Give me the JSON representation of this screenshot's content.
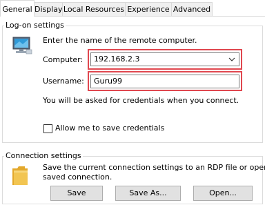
{
  "tabs": [
    "General",
    "Display",
    "Local Resources",
    "Experience",
    "Advanced"
  ],
  "logon": {
    "legend": "Log-on settings",
    "instruction": "Enter the name of the remote computer.",
    "computer_label": "Computer:",
    "computer_value": "192.168.2.3",
    "username_label": "Username:",
    "username_value": "Guru99",
    "credentials_note": "You will be asked for credentials when you connect.",
    "save_credentials_label": "Allow me to save credentials",
    "save_credentials_checked": false
  },
  "connection": {
    "legend": "Connection settings",
    "description_line1": "Save the current connection settings to an RDP file or open a",
    "description_line2": "saved connection.",
    "save_label": "Save",
    "save_as_label": "Save As...",
    "open_label": "Open..."
  },
  "colors": {
    "highlight": "#e0474f",
    "tab_inactive": "#f0f0f0",
    "button_face": "#e1e1e1",
    "folder": "#f2c552"
  },
  "icons": [
    "computer-icon",
    "chevron-down-icon",
    "folder-icon"
  ]
}
